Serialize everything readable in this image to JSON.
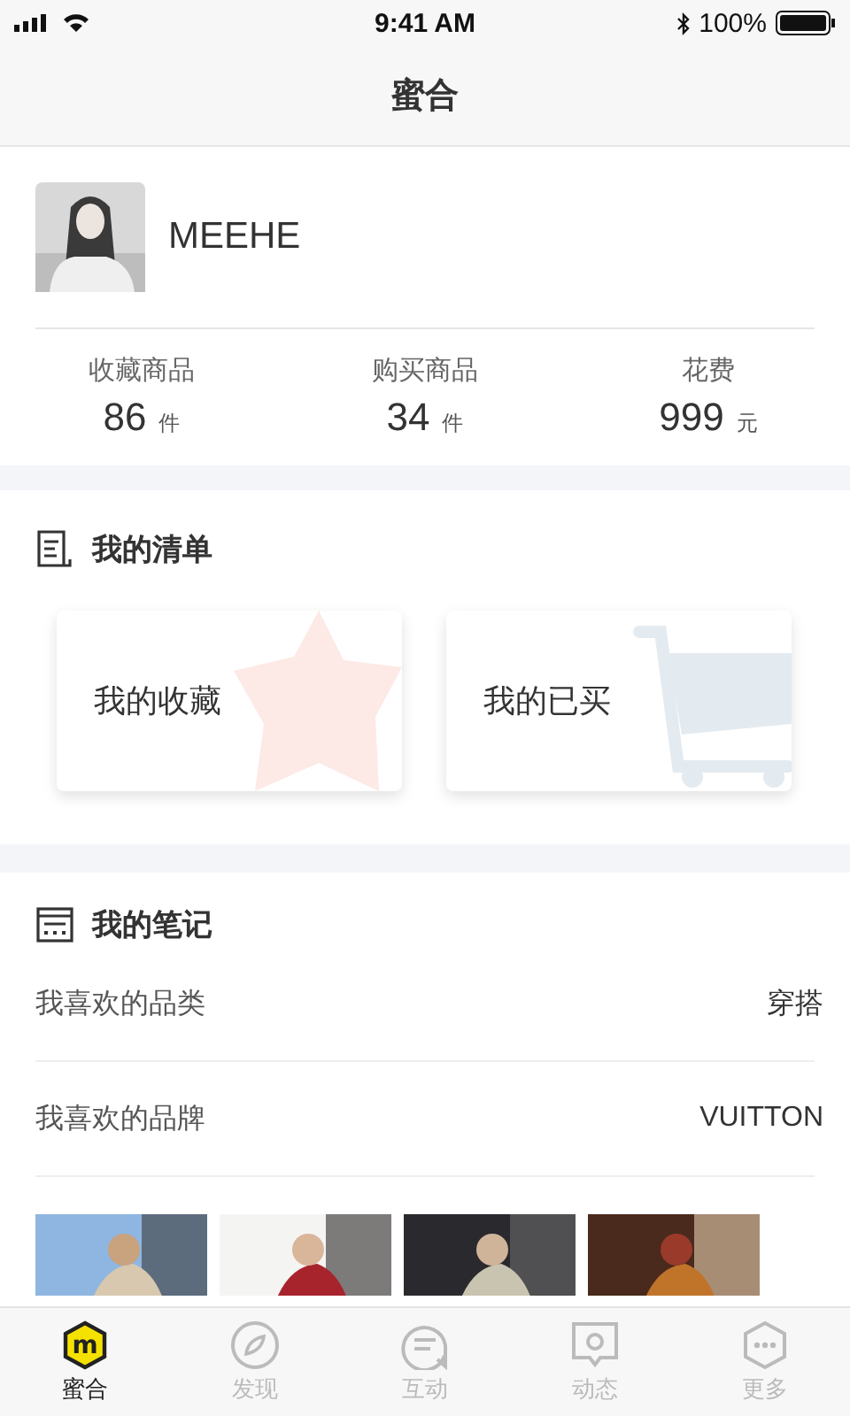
{
  "status_bar": {
    "time": "9:41 AM",
    "battery": "100%"
  },
  "nav": {
    "title": "蜜合"
  },
  "profile": {
    "name": "MEEHE"
  },
  "stats": [
    {
      "label": "收藏商品",
      "value": "86",
      "unit": "件"
    },
    {
      "label": "购买商品",
      "value": "34",
      "unit": "件"
    },
    {
      "label": "花费",
      "value": "999",
      "unit": "元"
    }
  ],
  "list_section": {
    "title": "我的清单",
    "cards": [
      {
        "label": "我的收藏",
        "kind": "star"
      },
      {
        "label": "我的已买",
        "kind": "cart"
      }
    ]
  },
  "notes_section": {
    "title": "我的笔记",
    "rows": [
      {
        "label": "我喜欢的品类",
        "value": "穿搭"
      },
      {
        "label": "我喜欢的品牌",
        "value": "VUITTON"
      }
    ]
  },
  "tab_bar": {
    "logo_letter": "m",
    "tabs": [
      {
        "label": "蜜合",
        "selected": true
      },
      {
        "label": "发现",
        "selected": false
      },
      {
        "label": "互动",
        "selected": false
      },
      {
        "label": "动态",
        "selected": false
      },
      {
        "label": "更多",
        "selected": false
      }
    ]
  }
}
